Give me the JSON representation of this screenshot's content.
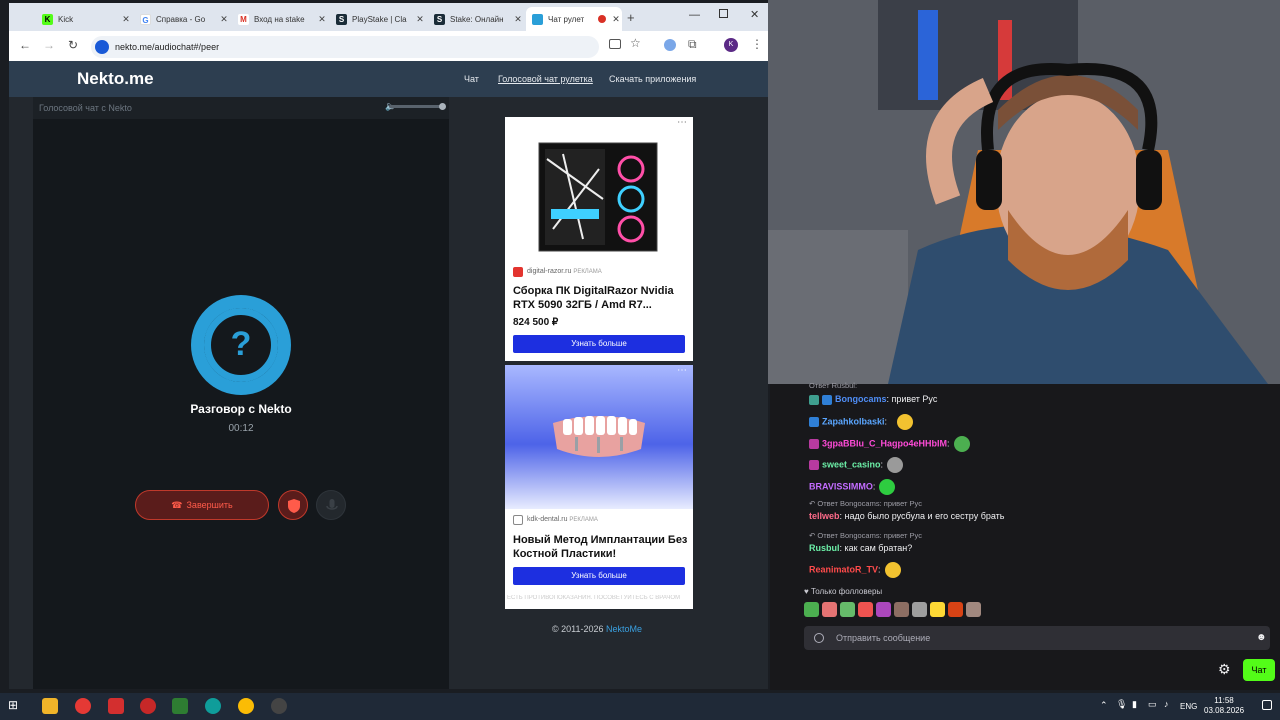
{
  "browser": {
    "tabs": [
      {
        "label": "Kick",
        "favicon_color": "#1a1a1a",
        "glyph": "K"
      },
      {
        "label": "Справка - Go",
        "favicon_color": "#ffffff",
        "glyph": "G"
      },
      {
        "label": "Вход на stake",
        "favicon_color": "#ffffff",
        "glyph": "M"
      },
      {
        "label": "PlayStake | Cla",
        "favicon_color": "#1a2c38",
        "glyph": "S"
      },
      {
        "label": "Stake: Онлайн",
        "favicon_color": "#1a2c38",
        "glyph": "S"
      },
      {
        "label": "Чат рулет",
        "favicon_color": "#2a9fd8",
        "glyph": ""
      }
    ],
    "new_tab_glyph": "+",
    "url": "nekto.me/audiochat#/peer",
    "profile_initial": "K"
  },
  "site": {
    "logo": "Nekto.me",
    "nav": [
      "Чат",
      "Голосовой чат рулетка",
      "Скачать приложения"
    ]
  },
  "voice": {
    "panel_title": "Голосовой чат с Nekto",
    "question_mark": "?",
    "conversation_title": "Разговор с Nekto",
    "timer": "00:12",
    "end_button": "Завершить"
  },
  "ads": [
    {
      "domain": "digital-razor.ru",
      "tag": "РЕКЛАМА",
      "title": "Сборка ПК DigitalRazor Nvidia RTX 5090 32ГБ / Amd R7...",
      "price": "824 500 ₽",
      "button": "Узнать больше"
    },
    {
      "domain": "kdk-dental.ru",
      "tag": "РЕКЛАМА",
      "title": "Новый Метод Имплантации Без Костной Пластики!",
      "disclaimer": "ЕСТЬ ПРОТИВОПОКАЗАНИЯ. ПОСОВЕТУЙТЕСЬ С ВРАЧОМ",
      "button": "Узнать больше"
    }
  ],
  "footer": {
    "copyright": "© 2011-2026",
    "brand": "NektoMe"
  },
  "stream_chat": {
    "top_reply": "Ответ Rusbul:",
    "messages": [
      {
        "type": "msg",
        "user": "Bongocams",
        "text": ": привет Рус",
        "color": "#4f8df5",
        "badge": "#3f9f8f"
      },
      {
        "type": "msg",
        "user": "Zapahkolbaski",
        "text": ":",
        "color": "#5aa6ff",
        "badge": "#2f7fd6"
      },
      {
        "type": "msg",
        "user": "3gpaBBIu_C_Hagpo4eHHbIM",
        "text": ":",
        "color": "#ff4bd8",
        "badge": "#b83aa0"
      },
      {
        "type": "msg",
        "user": "sweet_casino",
        "text": ":",
        "color": "#6cf0a8",
        "badge": "#b83aa0"
      },
      {
        "type": "msg",
        "user": "BRAVISSIMMO",
        "text": ":",
        "color": "#c36cff",
        "badge": ""
      },
      {
        "type": "reply",
        "text": "Ответ Bongocams: привет Рус"
      },
      {
        "type": "msg",
        "user": "tellweb",
        "text": ": надо было русбула и его сестру брать",
        "color": "#ff6b8a",
        "badge": ""
      },
      {
        "type": "reply",
        "text": "Ответ Bongocams: привет Рус"
      },
      {
        "type": "msg",
        "user": "Rusbul",
        "text": ": как сам братан?",
        "color": "#6cf0a8",
        "badge": ""
      },
      {
        "type": "msg",
        "user": "ReanimatoR_TV",
        "text": ":",
        "color": "#ff4b4b",
        "badge": ""
      }
    ],
    "followers_only": "Только фолловеры",
    "input_placeholder": "Отправить сообщение",
    "chat_button": "Чат"
  },
  "taskbar": {
    "lang": "ENG",
    "time": "11:58",
    "date": "03.08.2026"
  }
}
